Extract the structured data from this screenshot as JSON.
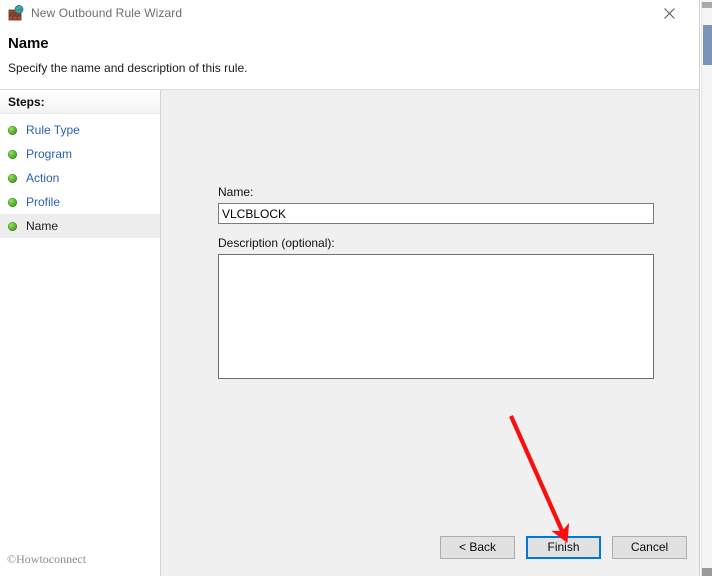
{
  "titlebar": {
    "icon": "firewall-globe-icon",
    "title": "New Outbound Rule Wizard",
    "close_label": "Close",
    "close_icon": "close-icon"
  },
  "header": {
    "title": "Name",
    "subtitle": "Specify the name and description of this rule."
  },
  "sidebar": {
    "heading": "Steps:",
    "items": [
      {
        "label": "Rule Type",
        "state": "completed",
        "bullet_icon": "green-dot-icon"
      },
      {
        "label": "Program",
        "state": "completed",
        "bullet_icon": "green-dot-icon"
      },
      {
        "label": "Action",
        "state": "completed",
        "bullet_icon": "green-dot-icon"
      },
      {
        "label": "Profile",
        "state": "completed",
        "bullet_icon": "green-dot-icon"
      },
      {
        "label": "Name",
        "state": "current",
        "bullet_icon": "green-dot-icon"
      }
    ]
  },
  "form": {
    "name_label": "Name:",
    "name_value": "VLCBLOCK",
    "name_placeholder": "",
    "description_label": "Description (optional):",
    "description_value": "",
    "description_placeholder": ""
  },
  "buttons": {
    "back": "< Back",
    "finish": "Finish",
    "cancel": "Cancel",
    "focused": "Finish"
  },
  "annotation": {
    "arrow_color": "#fc0d0d",
    "arrow_from": "512,417",
    "arrow_to": "565,537"
  },
  "watermark": {
    "text": "©Howtoconnect"
  },
  "colors": {
    "accent": "#0078d7",
    "link": "#2b5fb4",
    "content_bg": "#f0f0f0",
    "button_bg": "#e1e1e1",
    "scrollbar_thumb": "#7b94b8"
  }
}
